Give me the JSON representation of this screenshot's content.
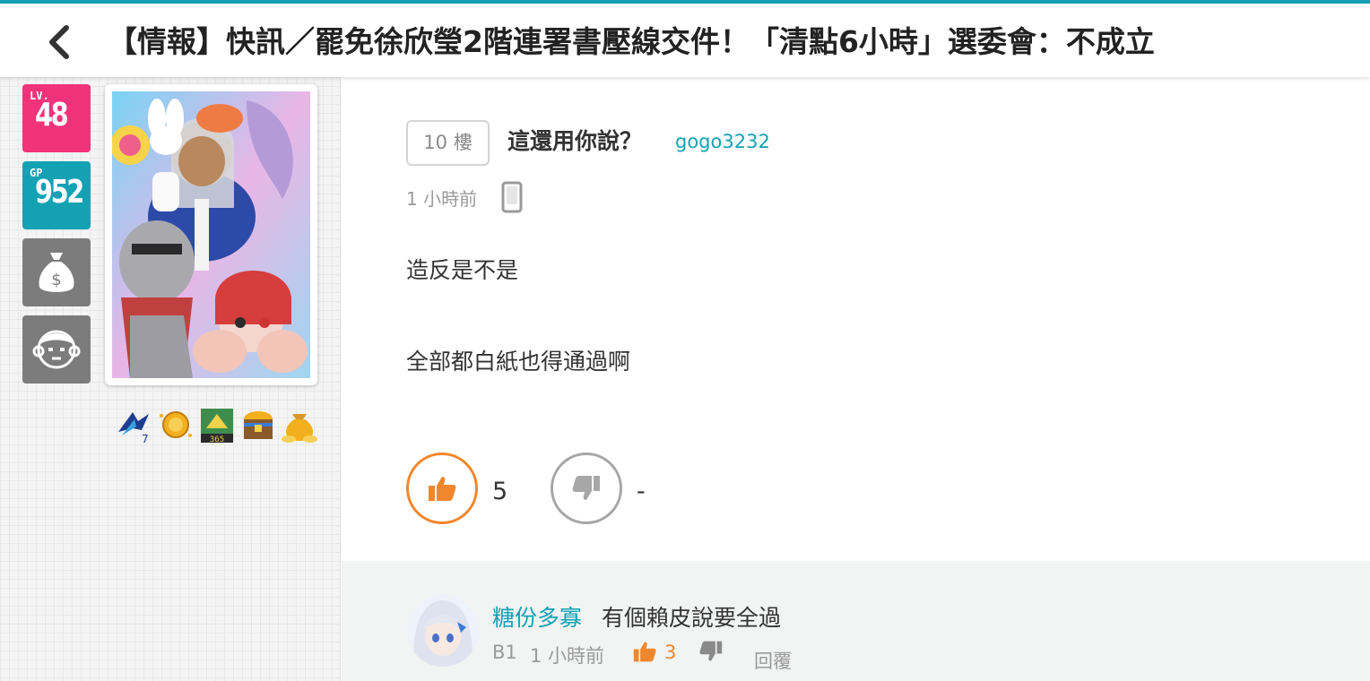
{
  "header": {
    "title": "【情報】快訊／罷免徐欣瑩2階連署書壓線交件！「清點6小時」選委會：不成立",
    "back_icon": "chevron-left-icon"
  },
  "sidebar": {
    "level_label": "LV.",
    "level_value": "48",
    "gp_label": "GP",
    "gp_value": "952",
    "money_icon": "money-bag-icon",
    "face_icon": "face-icon"
  },
  "post": {
    "floor_label": "10 樓",
    "author_name": "這還用你說？",
    "author_id": "gogo3232",
    "time": "1 小時前",
    "device_icon": "mobile-phone-icon",
    "body_lines": [
      "造反是不是",
      "全部都白紙也得通過啊"
    ],
    "likes": "5",
    "dislikes": "-"
  },
  "comment": {
    "name": "糖份多寡",
    "text": "有個賴皮說要全過",
    "floor": "B1",
    "time": "1 小時前",
    "likes": "3",
    "reply_label": "回覆"
  },
  "colors": {
    "accent": "#14a1b4",
    "level_badge": "#f0337a",
    "like_orange": "#f1872d",
    "gray_badge": "#7c7c7c"
  }
}
